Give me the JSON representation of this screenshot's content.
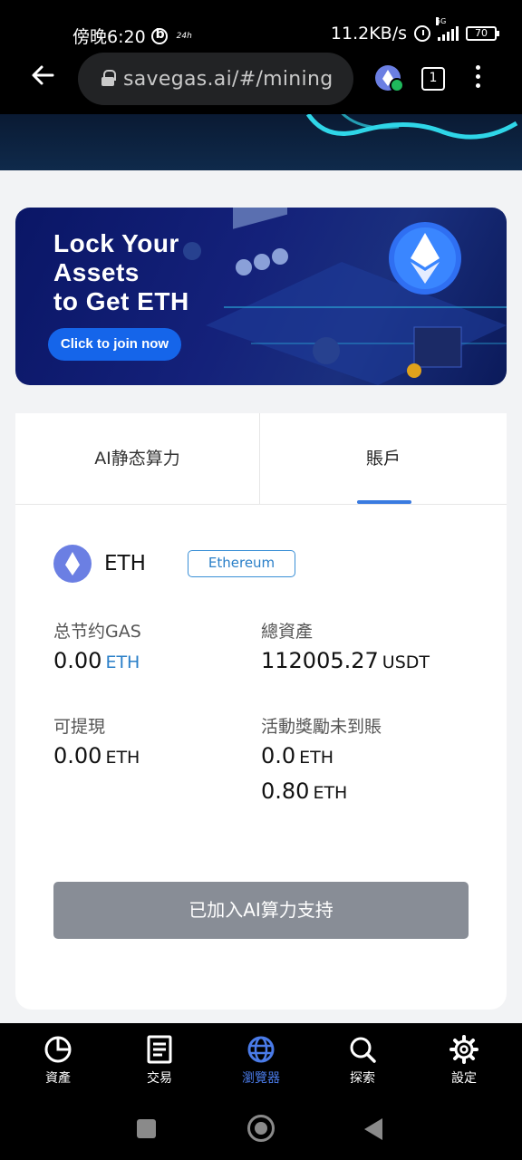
{
  "status_bar": {
    "time": "傍晚6:20",
    "mini_label": "24h",
    "net_speed": "11.2KB/s",
    "network": "5G",
    "battery": "70"
  },
  "browser": {
    "url": "savegas.ai/#/mining",
    "tab_count": "1"
  },
  "banner": {
    "title_lines": [
      "Lock Your",
      "Assets",
      "to Get ETH"
    ],
    "button_label": "Click to join now"
  },
  "tabs": [
    {
      "label": "AI静态算力",
      "active": false
    },
    {
      "label": "賬戶",
      "active": true
    }
  ],
  "coin": {
    "symbol": "ETH",
    "network": "Ethereum"
  },
  "stats": {
    "total_gas_saved": {
      "label": "总节约GAS",
      "value": "0.00",
      "unit": "ETH"
    },
    "total_assets": {
      "label": "總資產",
      "value": "112005.27",
      "unit": "USDT"
    },
    "withdrawable": {
      "label": "可提現",
      "value": "0.00",
      "unit": "ETH"
    },
    "pending_rewards": {
      "label": "活動獎勵未到賬",
      "value1": "0.0",
      "unit1": "ETH",
      "value2": "0.80",
      "unit2": "ETH"
    }
  },
  "joined_button": "已加入AI算力支持",
  "bottom_nav": [
    {
      "label": "資產",
      "icon": "pie-chart-icon"
    },
    {
      "label": "交易",
      "icon": "document-icon"
    },
    {
      "label": "瀏覽器",
      "icon": "globe-icon",
      "active": true
    },
    {
      "label": "探索",
      "icon": "search-icon"
    },
    {
      "label": "設定",
      "icon": "gear-icon"
    }
  ],
  "colors": {
    "accent": "#3a7be0",
    "eth": "#6b7fe3",
    "banner_button": "#1565ea",
    "joined_button": "#888d96"
  }
}
